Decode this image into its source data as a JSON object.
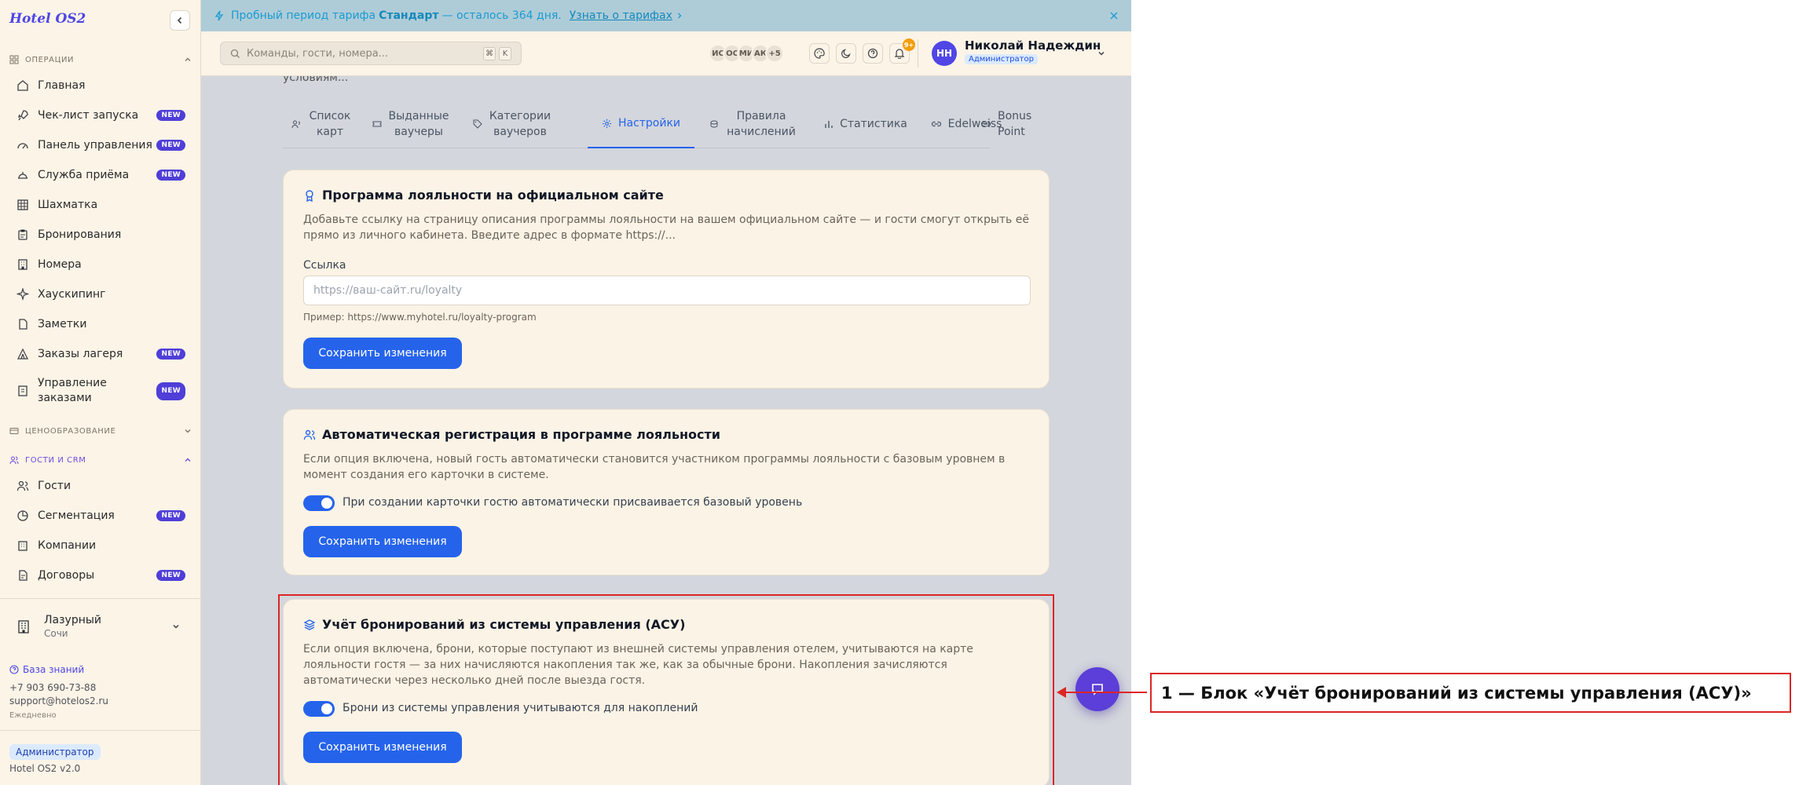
{
  "brand": "Hotel OS2",
  "sidebar": {
    "sections": {
      "operations": "ОПЕРАЦИИ",
      "pricing": "ЦЕНООБРАЗОВАНИЕ",
      "guests_crm": "ГОСТИ И CRM"
    },
    "items": [
      {
        "label": "Главная",
        "icon": "home-icon",
        "badge": ""
      },
      {
        "label": "Чек-лист запуска",
        "icon": "rocket-icon",
        "badge": "NEW"
      },
      {
        "label": "Панель управления",
        "icon": "gauge-icon",
        "badge": "NEW"
      },
      {
        "label": "Служба приёма",
        "icon": "bell-service-icon",
        "badge": "NEW"
      },
      {
        "label": "Шахматка",
        "icon": "grid-icon",
        "badge": ""
      },
      {
        "label": "Бронирования",
        "icon": "clipboard-icon",
        "badge": ""
      },
      {
        "label": "Номера",
        "icon": "building-icon",
        "badge": ""
      },
      {
        "label": "Хаусkипинг",
        "icon": "sparkle-icon",
        "badge": ""
      },
      {
        "label": "Заметки",
        "icon": "file-icon",
        "badge": ""
      },
      {
        "label": "Заказы лагеря",
        "icon": "tent-icon",
        "badge": "NEW"
      },
      {
        "label": "Управление заказами",
        "icon": "receipt-icon",
        "badge": "NEW"
      },
      {
        "label": "Гости",
        "icon": "users-icon",
        "badge": ""
      },
      {
        "label": "Сегментация",
        "icon": "pie-icon",
        "badge": "NEW"
      },
      {
        "label": "Компании",
        "icon": "company-icon",
        "badge": ""
      },
      {
        "label": "Договоры",
        "icon": "contract-icon",
        "badge": "NEW"
      }
    ],
    "hotel": {
      "name": "Лазурный",
      "city": "Сочи"
    },
    "knowledge_base": "База знаний",
    "phone": "+7 903 690-73-88",
    "email": "support@hotelos2.ru",
    "hours": "Ежедневно",
    "role": "Администратор",
    "version": "Hotel OS2 v2.0"
  },
  "banner": {
    "pre": "Пробный период тарифа",
    "plan": "Стандарт",
    "post": "— осталось 364 дня.",
    "link": "Узнать о тарифах"
  },
  "topbar": {
    "search_placeholder": "Команды, гости, номера...",
    "kbd1": "⌘",
    "kbd2": "K",
    "presence": [
      "ИС",
      "ОС",
      "МИ",
      "АК",
      "+5"
    ],
    "notif_count": "9+",
    "user_initials": "НН",
    "user_name": "Николай Надеждин",
    "user_role": "Администратор"
  },
  "content": {
    "partial_text": "условиям...",
    "tabs": [
      {
        "label": "Список карт",
        "icon": "users-icon"
      },
      {
        "label": "Выданные ваучеры",
        "icon": "ticket-icon"
      },
      {
        "label": "Категории ваучеров",
        "icon": "tag-icon"
      },
      {
        "label": "Настройки",
        "icon": "gear-icon"
      },
      {
        "label": "Правила начислений",
        "icon": "coins-icon"
      },
      {
        "label": "Статистика",
        "icon": "bars-icon"
      },
      {
        "label": "Edelweiss",
        "icon": "link-icon"
      },
      {
        "label": "Bonus Point",
        "icon": "link-icon"
      }
    ],
    "card1": {
      "title": "Программа лояльности на официальном сайте",
      "desc": "Добавьте ссылку на страницу описания программы лояльности на вашем официальном сайте — и гости смогут открыть её прямо из личного кабинета. Введите адрес в формате https://...",
      "field_label": "Ссылка",
      "field_placeholder": "https://ваш-сайт.ru/loyalty",
      "hint": "Пример: https://www.myhotel.ru/loyalty-program",
      "save": "Сохранить изменения"
    },
    "card2": {
      "title": "Автоматическая регистрация в программе лояльности",
      "desc": "Если опция включена, новый гость автоматически становится участником программы лояльности с базовым уровнем в момент создания его карточки в системе.",
      "toggle_label": "При создании карточки гостю автоматически присваивается базовый уровень",
      "save": "Сохранить изменения"
    },
    "card3": {
      "title": "Учёт бронирований из системы управления (АСУ)",
      "desc": "Если опция включена, брони, которые поступают из внешней системы управления отелем, учитываются на карте лояльности гостя — за них начисляются накопления так же, как за обычные брони. Накопления зачисляются автоматически через несколько дней после выезда гостя.",
      "toggle_label": "Брони из системы управления учитываются для накоплений",
      "save": "Сохранить изменения"
    }
  },
  "callout": "1 — Блок «Учёт бронирований из системы управления (АСУ)»",
  "colors": {
    "accent": "#2563eb",
    "brand": "#4f46e5",
    "highlight": "#dc2626"
  }
}
